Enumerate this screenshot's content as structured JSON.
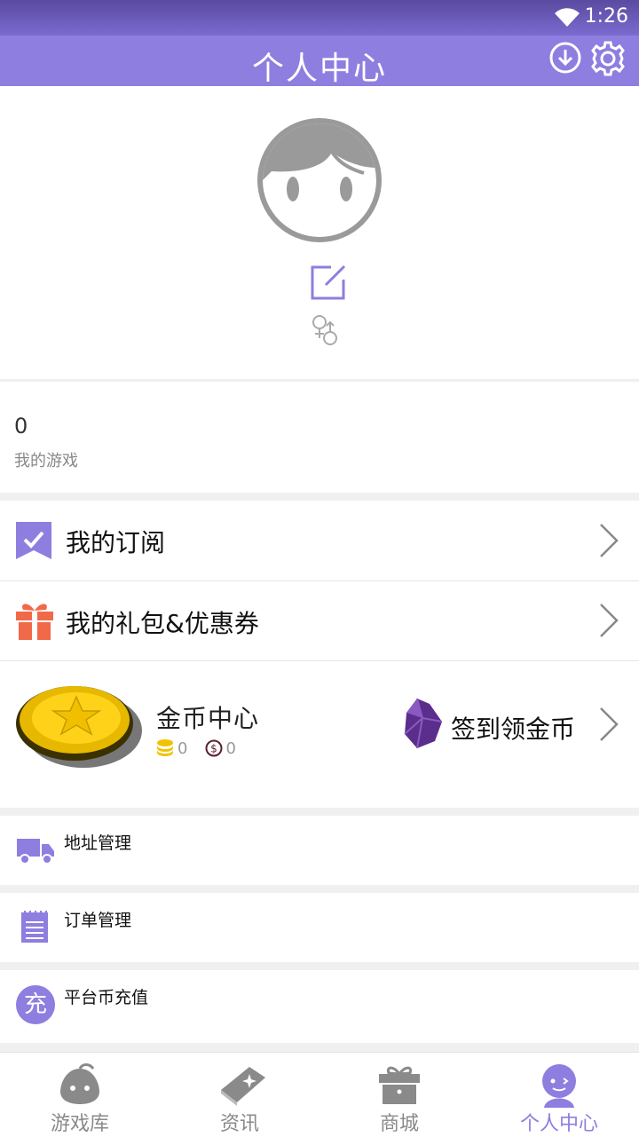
{
  "status_bar": {
    "time": "1:26"
  },
  "header": {
    "title": "个人中心"
  },
  "profile": {
    "games_count": "0",
    "games_label": "我的游戏"
  },
  "menu": {
    "subscribe": "我的订阅",
    "gifts": "我的礼包&优惠券",
    "coin_center": "金币中心",
    "gold_count": "0",
    "coin_count": "0",
    "sign_in": "签到领金币",
    "address": "地址管理",
    "orders": "订单管理",
    "recharge": "平台币充值",
    "recharge_badge": "充"
  },
  "nav": {
    "items": [
      {
        "label": "游戏库"
      },
      {
        "label": "资讯"
      },
      {
        "label": "商城"
      },
      {
        "label": "个人中心"
      }
    ],
    "active_index": 3
  },
  "colors": {
    "accent": "#8e7ee0",
    "gift": "#f06a4a",
    "coin": "#f2c200"
  }
}
